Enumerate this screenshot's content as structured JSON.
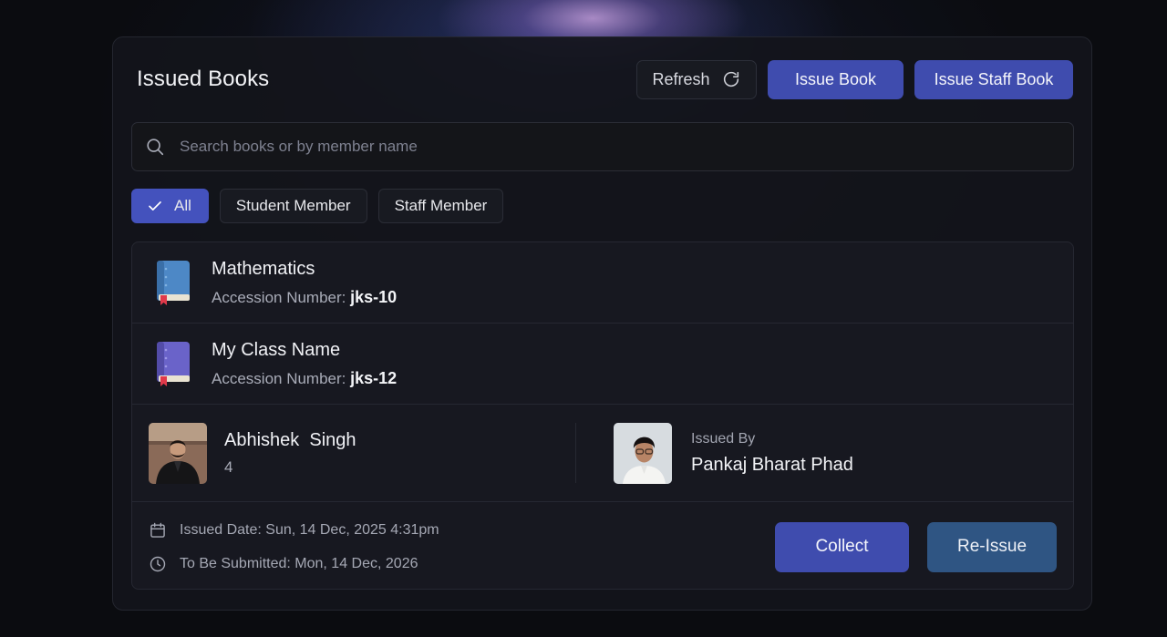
{
  "header": {
    "title": "Issued Books",
    "refresh_label": "Refresh",
    "issue_book_label": "Issue Book",
    "issue_staff_book_label": "Issue Staff Book"
  },
  "search": {
    "placeholder": "Search books or by member name",
    "value": ""
  },
  "filters": [
    {
      "label": "All",
      "active": true
    },
    {
      "label": "Student Member",
      "active": false
    },
    {
      "label": "Staff Member",
      "active": false
    }
  ],
  "issue_card": {
    "books": [
      {
        "title": "Mathematics",
        "accession_label": "Accession Number:",
        "accession_number": "jks-10",
        "icon": "book-icon",
        "color": "#4d88c6"
      },
      {
        "title": "My Class Name",
        "accession_label": "Accession Number:",
        "accession_number": "jks-12",
        "icon": "book-icon",
        "color": "#6a63c9"
      }
    ],
    "member": {
      "name": "Abhishek  Singh",
      "count": "4",
      "avatar": "member-avatar"
    },
    "issuer": {
      "label": "Issued By",
      "name": "Pankaj Bharat Phad",
      "avatar": "issuer-avatar"
    },
    "issued_date": "Issued Date: Sun, 14 Dec, 2025 4:31pm",
    "due_date": "To Be Submitted: Mon, 14 Dec, 2026",
    "collect_label": "Collect",
    "reissue_label": "Re-Issue"
  },
  "colors": {
    "primary": "#3f4cae",
    "filter_active": "#4452bd",
    "reissue": "#2f5583",
    "background": "#0b0c10"
  }
}
